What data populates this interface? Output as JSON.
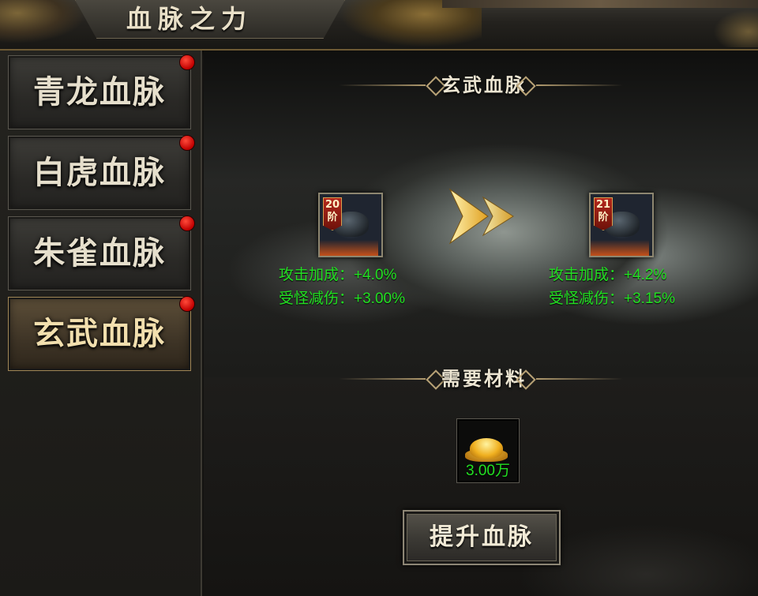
{
  "header": {
    "title": "血脉之力"
  },
  "sidebar": {
    "items": [
      {
        "label": "青龙血脉",
        "active": false,
        "has_notification": true
      },
      {
        "label": "白虎血脉",
        "active": false,
        "has_notification": true
      },
      {
        "label": "朱雀血脉",
        "active": false,
        "has_notification": true
      },
      {
        "label": "玄武血脉",
        "active": true,
        "has_notification": true
      }
    ]
  },
  "main": {
    "bloodline_title": "玄武血脉",
    "current": {
      "stage": "20",
      "stage_unit": "阶",
      "attack_bonus": "攻击加成：+4.0%",
      "damage_reduction": "受怪减伤：+3.00%"
    },
    "next": {
      "stage": "21",
      "stage_unit": "阶",
      "attack_bonus": "攻击加成：+4.2%",
      "damage_reduction": "受怪减伤：+3.15%"
    },
    "arrow_icon": "double-chevron-right-icon",
    "materials_title": "需要材料",
    "material": {
      "icon": "gold-ingot-icon",
      "count": "3.00万"
    },
    "upgrade_button": "提升血脉"
  },
  "colors": {
    "stat_green": "#22e022",
    "notification_red": "#d00000",
    "accent_gold": "#b09a6e"
  }
}
